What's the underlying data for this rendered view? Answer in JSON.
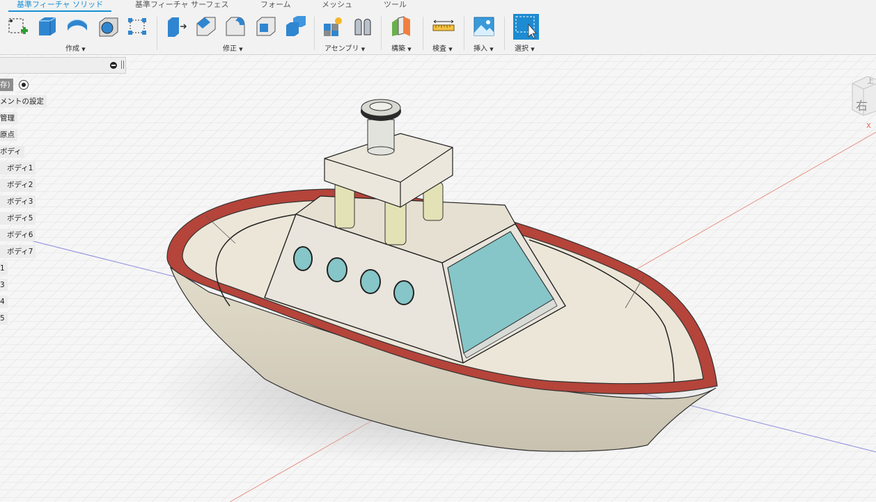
{
  "tabs": [
    "基準フィーチャ ソリッド",
    "基準フィーチャ サーフェス",
    "フォーム",
    "メッシュ",
    "ツール"
  ],
  "groups": {
    "create": "作成",
    "modify": "修正",
    "assemble": "アセンブリ",
    "construct": "構築",
    "inspect": "検査",
    "insert": "挿入",
    "select": "選択"
  },
  "browser": {
    "items": [
      "存)",
      "メントの設定",
      "管理",
      "原点",
      "ボディ",
      "ボディ1",
      "ボディ2",
      "ボディ3",
      "ボディ5",
      "ボディ6",
      "ボディ7",
      "1",
      "3",
      "4",
      "5"
    ]
  },
  "viewcube": {
    "face": "右",
    "top": "上",
    "axis": "X"
  },
  "colors": {
    "accent": "#1a8fd6",
    "hull_trim": "#b5443a",
    "hull": "#ece6d8",
    "window": "#86c6c8",
    "pillar": "#e3e2b6"
  }
}
